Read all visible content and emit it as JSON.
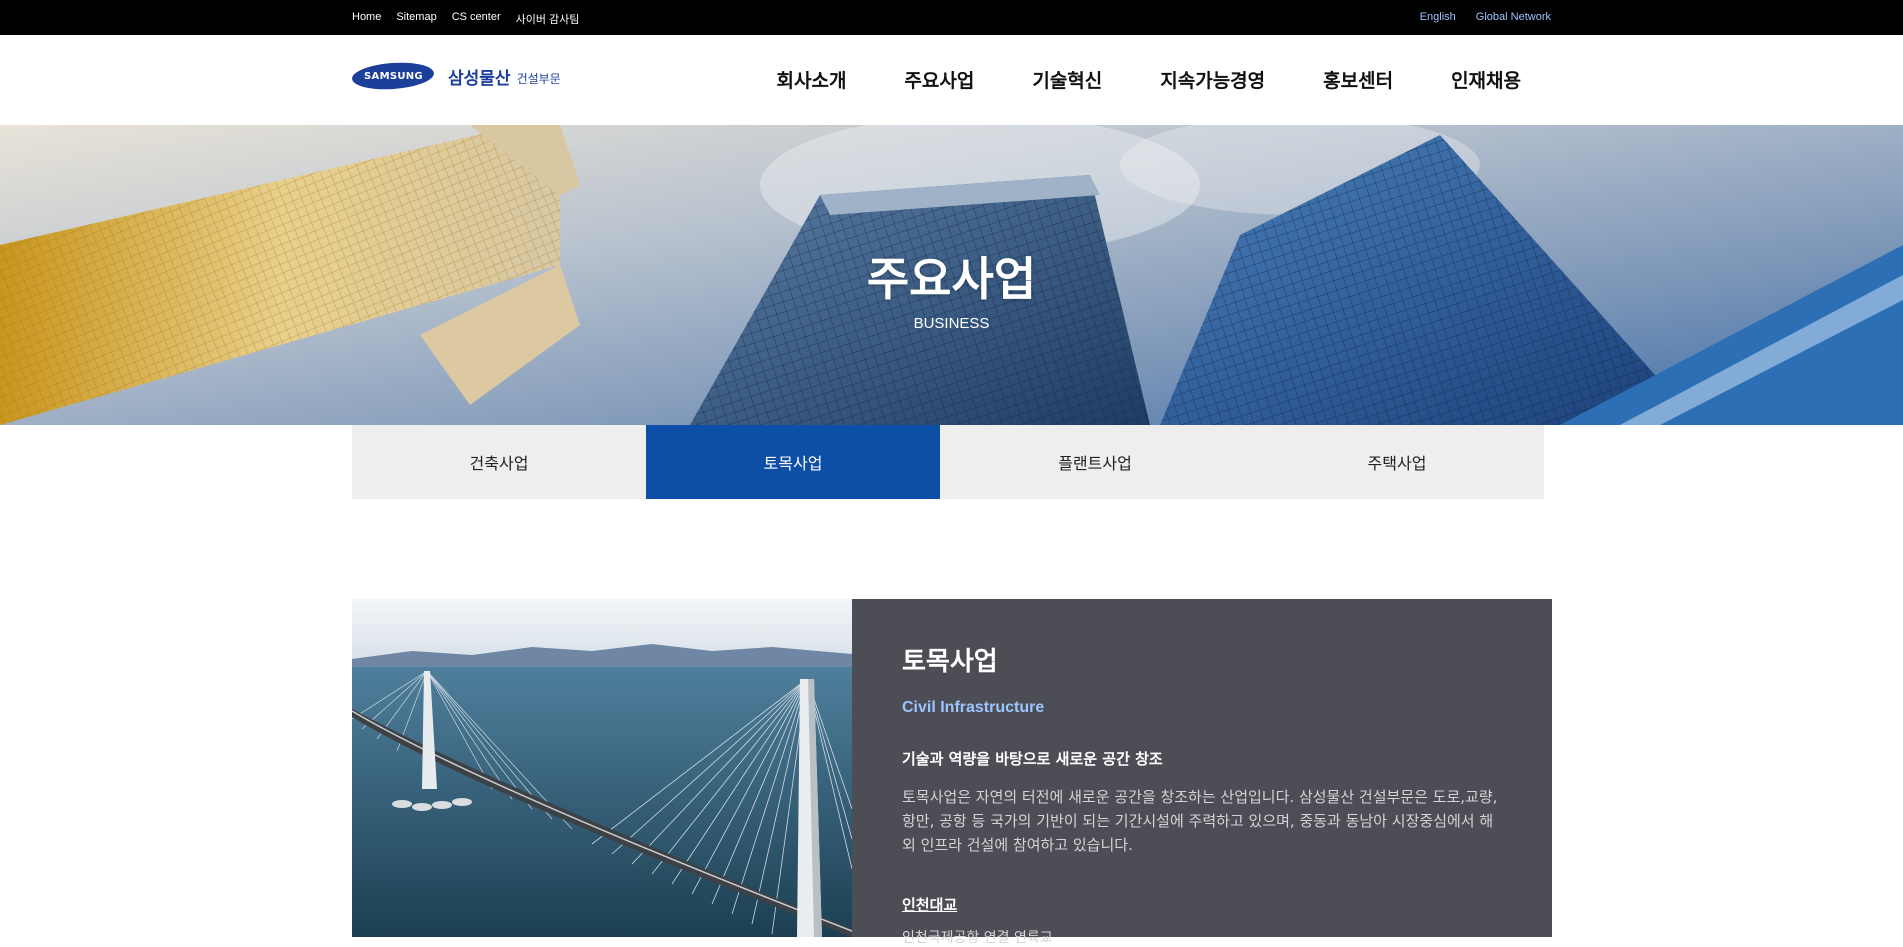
{
  "topbar": {
    "links": [
      "Home",
      "Sitemap",
      "CS center",
      "사이버 감사팀"
    ],
    "right_links": [
      "English",
      "Global Network"
    ]
  },
  "header": {
    "logo_mark": "SAMSUNG",
    "logo_name": "삼성물산",
    "logo_sub": "건설부문",
    "nav": [
      "회사소개",
      "주요사업",
      "기술혁신",
      "지속가능경영",
      "홍보센터",
      "인재채용"
    ]
  },
  "hero": {
    "title": "주요사업",
    "subtitle": "BUSINESS"
  },
  "tabs": {
    "items": [
      "건축사업",
      "토목사업",
      "플랜트사업",
      "주택사업"
    ],
    "active": "토목사업"
  },
  "content": {
    "title": "토목사업",
    "subtitle_en": "Civil Infrastructure",
    "lead": "기술과 역량을 바탕으로 새로운 공간 창조",
    "description": "토목사업은 자연의 터전에 새로운 공간을 창조하는 산업입니다. 삼성물산 건설부문은 도로,교량, 항만, 공항 등 국가의 기반이 되는 기간시설에 주력하고 있으며, 중동과 동남아 시장중심에서 해외 인프라 건설에 참여하고 있습니다.",
    "project_title": "인천대교",
    "project_desc": "인천국제공항 연결 연륙교"
  },
  "colors": {
    "topbar_bg": "#000000",
    "brand_blue": "#1c3f9c",
    "tab_active": "#0d4ea6",
    "info_panel": "#4d4e55",
    "accent_link": "#9cc5ff"
  }
}
